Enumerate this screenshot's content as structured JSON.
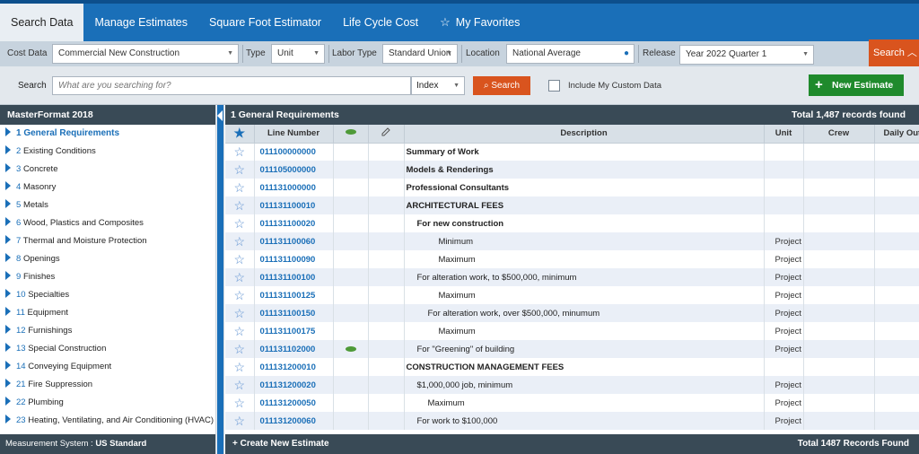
{
  "nav": {
    "tabs": [
      {
        "label": "Search Data",
        "active": true
      },
      {
        "label": "Manage Estimates",
        "active": false
      },
      {
        "label": "Square Foot Estimator",
        "active": false
      },
      {
        "label": "Life Cycle Cost",
        "active": false
      },
      {
        "label": "My Favorites",
        "active": false
      }
    ]
  },
  "filters": {
    "cost_data_label": "Cost Data",
    "cost_data_value": "Commercial New Construction",
    "type_label": "Type",
    "type_value": "Unit",
    "labor_type_label": "Labor Type",
    "labor_type_value": "Standard Union",
    "location_label": "Location",
    "location_value": "National Average",
    "release_label": "Release",
    "release_value": "Year 2022 Quarter 1",
    "search_button": "Search"
  },
  "search": {
    "label": "Search",
    "placeholder": "What are you searching for?",
    "index_value": "Index",
    "search_button": "Search",
    "custom_data_label": "Include My Custom Data",
    "new_estimate_button": "New Estimate"
  },
  "sidebar": {
    "title": "MasterFormat 2018",
    "items": [
      {
        "num": "1",
        "label": "General Requirements",
        "active": true
      },
      {
        "num": "2",
        "label": "Existing Conditions"
      },
      {
        "num": "3",
        "label": "Concrete"
      },
      {
        "num": "4",
        "label": "Masonry"
      },
      {
        "num": "5",
        "label": "Metals"
      },
      {
        "num": "6",
        "label": "Wood, Plastics and Composites"
      },
      {
        "num": "7",
        "label": "Thermal and Moisture Protection"
      },
      {
        "num": "8",
        "label": "Openings"
      },
      {
        "num": "9",
        "label": "Finishes"
      },
      {
        "num": "10",
        "label": "Specialties"
      },
      {
        "num": "11",
        "label": "Equipment"
      },
      {
        "num": "12",
        "label": "Furnishings"
      },
      {
        "num": "13",
        "label": "Special Construction"
      },
      {
        "num": "14",
        "label": "Conveying Equipment"
      },
      {
        "num": "21",
        "label": "Fire Suppression"
      },
      {
        "num": "22",
        "label": "Plumbing"
      },
      {
        "num": "23",
        "label": "Heating, Ventilating, and Air Conditioning (HVAC)"
      }
    ],
    "measurement_label": "Measurement System : ",
    "measurement_value": "US Standard"
  },
  "grid": {
    "title": "1 General Requirements",
    "total_top": "Total 1,487 records found",
    "columns": {
      "line_number": "Line Number",
      "description": "Description",
      "unit": "Unit",
      "crew": "Crew",
      "daily_output": "Daily Output"
    },
    "rows": [
      {
        "line": "011100000000",
        "desc": "Summary of Work",
        "unit": "",
        "indent": 0,
        "bold": true,
        "green": false
      },
      {
        "line": "011105000000",
        "desc": "Models & Renderings",
        "unit": "",
        "indent": 0,
        "bold": true,
        "green": false
      },
      {
        "line": "011131000000",
        "desc": "Professional Consultants",
        "unit": "",
        "indent": 0,
        "bold": true,
        "green": false
      },
      {
        "line": "011131100010",
        "desc": "ARCHITECTURAL FEES",
        "unit": "",
        "indent": 0,
        "bold": true,
        "green": false
      },
      {
        "line": "011131100020",
        "desc": "For new construction",
        "unit": "",
        "indent": 1,
        "bold": true,
        "green": false
      },
      {
        "line": "011131100060",
        "desc": "Minimum",
        "unit": "Project",
        "indent": 3,
        "bold": false,
        "green": false
      },
      {
        "line": "011131100090",
        "desc": "Maximum",
        "unit": "Project",
        "indent": 3,
        "bold": false,
        "green": false
      },
      {
        "line": "011131100100",
        "desc": "For alteration work, to $500,000, minimum",
        "unit": "Project",
        "indent": 1,
        "bold": false,
        "green": false
      },
      {
        "line": "011131100125",
        "desc": "Maximum",
        "unit": "Project",
        "indent": 3,
        "bold": false,
        "green": false
      },
      {
        "line": "011131100150",
        "desc": "For alteration work, over $500,000, minumum",
        "unit": "Project",
        "indent": 2,
        "bold": false,
        "green": false
      },
      {
        "line": "011131100175",
        "desc": "Maximum",
        "unit": "Project",
        "indent": 3,
        "bold": false,
        "green": false
      },
      {
        "line": "011131102000",
        "desc": "For \"Greening\" of building",
        "unit": "Project",
        "indent": 1,
        "bold": false,
        "green": true
      },
      {
        "line": "011131200010",
        "desc": "CONSTRUCTION MANAGEMENT FEES",
        "unit": "",
        "indent": 0,
        "bold": true,
        "green": false
      },
      {
        "line": "011131200020",
        "desc": "$1,000,000 job, minimum",
        "unit": "Project",
        "indent": 1,
        "bold": false,
        "green": false
      },
      {
        "line": "011131200050",
        "desc": "Maximum",
        "unit": "Project",
        "indent": 2,
        "bold": false,
        "green": false
      },
      {
        "line": "011131200060",
        "desc": "For work to $100,000",
        "unit": "Project",
        "indent": 1,
        "bold": false,
        "green": false
      }
    ],
    "create_estimate": "Create New Estimate",
    "total_bottom": "Total 1487 Records Found"
  },
  "colors": {
    "nav_blue": "#1a6fb8",
    "header_dark": "#394a56",
    "accent_orange": "#d9541e",
    "new_green": "#1f8a2c",
    "leaf_green": "#4e9a38"
  }
}
